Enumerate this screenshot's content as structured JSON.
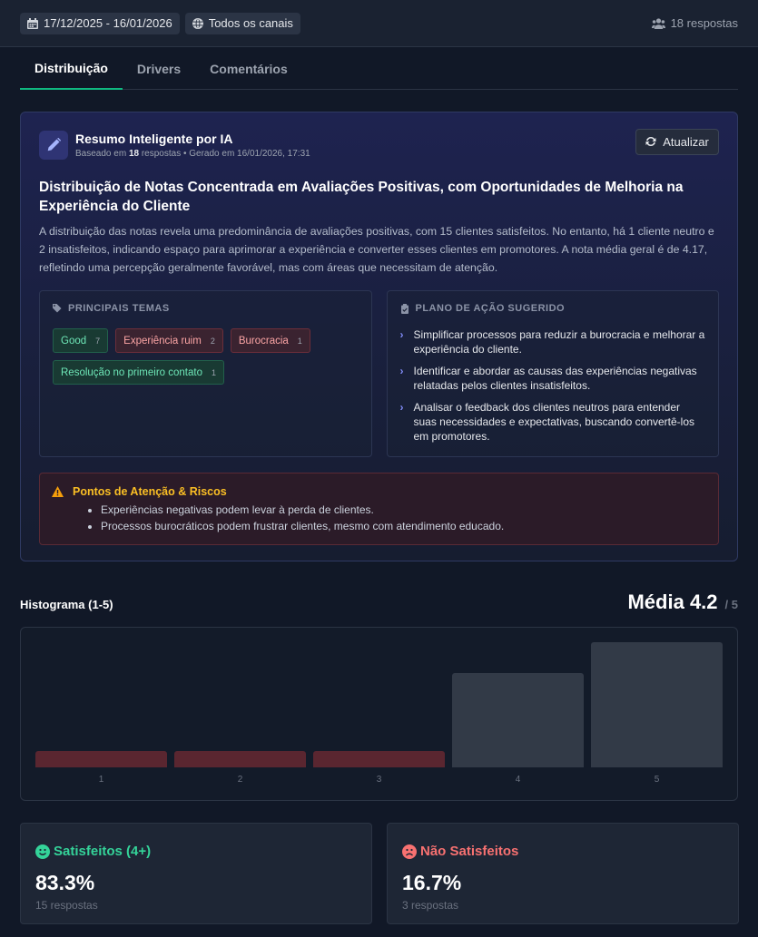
{
  "topbar": {
    "date_range": "17/12/2025 - 16/01/2026",
    "channel": "Todos os canais",
    "responses": "18 respostas"
  },
  "tabs": [
    {
      "label": "Distribuição",
      "active": true
    },
    {
      "label": "Drivers",
      "active": false
    },
    {
      "label": "Comentários",
      "active": false
    }
  ],
  "ai_summary": {
    "title": "Resumo Inteligente por IA",
    "sub_prefix": "Baseado em ",
    "sub_count": "18",
    "sub_suffix": " respostas • Gerado em 16/01/2026, 17:31",
    "refresh_label": "Atualizar",
    "headline": "Distribuição de Notas Concentrada em Avaliações Positivas, com Oportunidades de Melhoria na Experiência do Cliente",
    "body": "A distribuição das notas revela uma predominância de avaliações positivas, com 15 clientes satisfeitos. No entanto, há 1 cliente neutro e 2 insatisfeitos, indicando espaço para aprimorar a experiência e converter esses clientes em promotores. A nota média geral é de 4.17, refletindo uma percepção geralmente favorável, mas com áreas que necessitam de atenção.",
    "themes_title": "PRINCIPAIS TEMAS",
    "themes": [
      {
        "label": "Good",
        "count": "7",
        "tone": "pos"
      },
      {
        "label": "Experiência ruim",
        "count": "2",
        "tone": "neg"
      },
      {
        "label": "Burocracia",
        "count": "1",
        "tone": "neg"
      },
      {
        "label": "Resolução no primeiro contato",
        "count": "1",
        "tone": "pos"
      }
    ],
    "plan_title": "PLANO DE AÇÃO SUGERIDO",
    "plan": [
      "Simplificar processos para reduzir a burocracia e melhorar a experiência do cliente.",
      "Identificar e abordar as causas das experiências negativas relatadas pelos clientes insatisfeitos.",
      "Analisar o feedback dos clientes neutros para entender suas necessidades e expectativas, buscando convertê-los em promotores."
    ],
    "risks_title": "Pontos de Atenção & Riscos",
    "risks": [
      "Experiências negativas podem levar à perda de clientes.",
      "Processos burocráticos podem frustrar clientes, mesmo com atendimento educado."
    ]
  },
  "histogram": {
    "title": "Histograma (1-5)",
    "average_label": "Média 4.2",
    "average_max": "/ 5"
  },
  "chart_data": {
    "type": "bar",
    "categories": [
      "1",
      "2",
      "3",
      "4",
      "5"
    ],
    "values": [
      1,
      1,
      1,
      6,
      8
    ],
    "ylim": [
      0,
      8
    ]
  },
  "stats": {
    "satisfied": {
      "title": "Satisfeitos (4+)",
      "value": "83.3%",
      "sub": "15 respostas"
    },
    "unsatisfied": {
      "title": "Não Satisfeitos",
      "value": "16.7%",
      "sub": "3 respostas"
    }
  },
  "colors": {
    "accent": "#10b981",
    "low_bar": "#5a2630",
    "high_bar": "#323a47",
    "positive": "#34d399",
    "negative": "#f87171",
    "warning": "#fbbf24"
  }
}
